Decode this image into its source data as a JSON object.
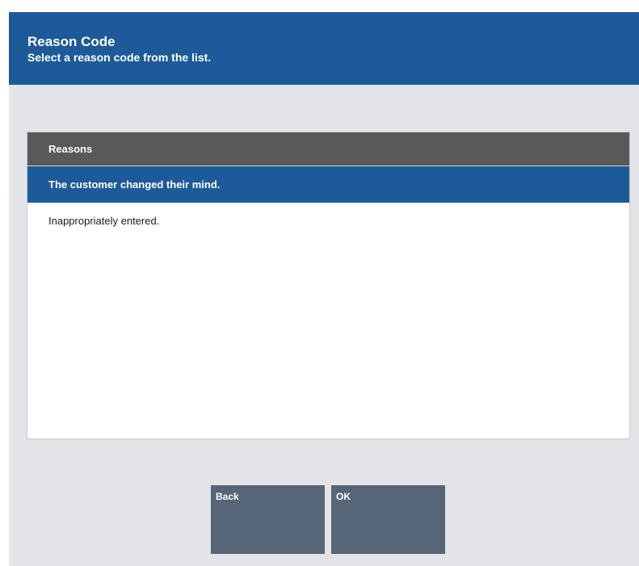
{
  "header": {
    "title": "Reason Code",
    "subtitle": "Select a reason code from the list."
  },
  "list": {
    "header": "Reasons",
    "items": [
      {
        "label": "The customer changed their mind.",
        "selected": true
      },
      {
        "label": "Inappropriately entered.",
        "selected": false
      }
    ]
  },
  "buttons": {
    "back_label": "Back",
    "ok_label": "OK"
  },
  "colors": {
    "header_bg": "#1d5a9a",
    "list_header_bg": "#595959",
    "selected_bg": "#1d5a9a",
    "button_bg": "#566578",
    "screen_bg": "#e2e4e7"
  }
}
